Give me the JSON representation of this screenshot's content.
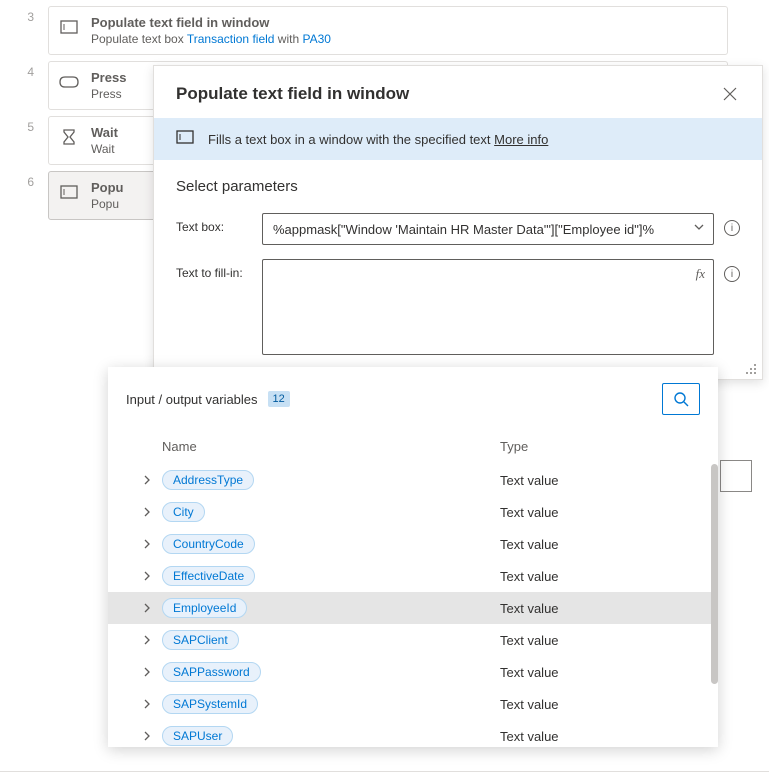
{
  "steps": [
    {
      "num": "3",
      "title": "Populate text field in window",
      "sub_pre": "Populate text box ",
      "sub_link1": "Transaction field",
      "sub_mid": " with ",
      "sub_link2": "PA30",
      "icon": "textbox"
    },
    {
      "num": "4",
      "title": "Press",
      "sub_pre": "Press",
      "icon": "keyboard"
    },
    {
      "num": "5",
      "title": "Wait",
      "sub_pre": "Wait",
      "icon": "hourglass"
    },
    {
      "num": "6",
      "title": "Popu",
      "sub_pre": "Popu",
      "icon": "textbox",
      "selected": true
    }
  ],
  "dialog": {
    "title": "Populate text field in window",
    "banner_text": "Fills a text box in a window with the specified text ",
    "more_info": "More info",
    "section": "Select parameters",
    "param1_label": "Text box:",
    "param1_value": "%appmask[\"Window 'Maintain HR Master Data'\"][\"Employee id\"]%",
    "param2_label": "Text to fill-in:",
    "fx": "fx"
  },
  "variables": {
    "title": "Input / output variables",
    "count": "12",
    "col_name": "Name",
    "col_type": "Type",
    "rows": [
      {
        "name": "AddressType",
        "type": "Text value"
      },
      {
        "name": "City",
        "type": "Text value"
      },
      {
        "name": "CountryCode",
        "type": "Text value"
      },
      {
        "name": "EffectiveDate",
        "type": "Text value"
      },
      {
        "name": "EmployeeId",
        "type": "Text value",
        "hover": true
      },
      {
        "name": "SAPClient",
        "type": "Text value"
      },
      {
        "name": "SAPPassword",
        "type": "Text value"
      },
      {
        "name": "SAPSystemId",
        "type": "Text value"
      },
      {
        "name": "SAPUser",
        "type": "Text value"
      }
    ]
  }
}
